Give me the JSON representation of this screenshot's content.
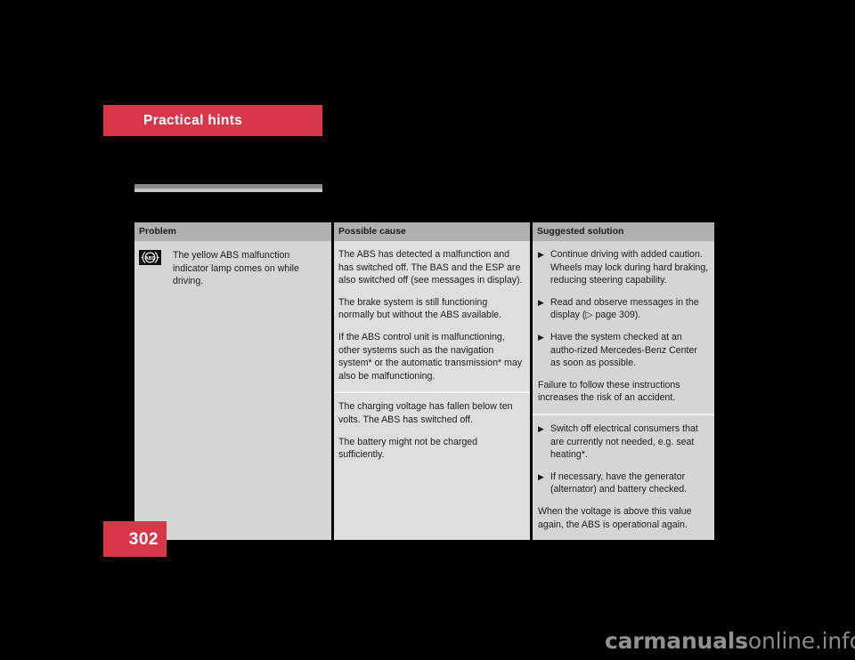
{
  "document": {
    "section_title": "Practical hints",
    "page_number": "302",
    "watermark_strong": "carmanuals",
    "watermark_light": "online.info",
    "accent_color": "#d8374a",
    "table_header_bg": "#b0b0b0",
    "table_body_bg": "#d5d5d5"
  },
  "table": {
    "headers": {
      "problem": "Problem",
      "possible_cause": "Possible cause",
      "suggested_solution": "Suggested solution"
    },
    "rows": [
      {
        "problem": {
          "icon": "abs-warning-lamp-icon",
          "text": "The yellow ABS malfunction indicator lamp comes on while driving."
        },
        "possible_cause": [
          "The ABS has detected a malfunction and has switched off. The BAS and the ESP are also switched off (see messages in display).",
          "The brake system is still functioning normally but without the ABS available.",
          "If the ABS control unit is malfunctioning, other systems such as the navigation system* or the automatic transmission* may also be malfunctioning."
        ],
        "suggested_solution": {
          "bullets": [
            "Continue driving with added caution. Wheels may lock during hard braking, reducing steering capability.",
            "Read and observe messages in the display (▷ page 309).",
            "Have the system checked at an autho-rized Mercedes-Benz Center as soon as possible."
          ],
          "note": "Failure to follow these instructions increases the risk of an accident."
        }
      },
      {
        "problem": {
          "icon": "",
          "text": ""
        },
        "possible_cause": [
          "The charging voltage has fallen below ten volts. The ABS has switched off.",
          "The battery might not be charged sufficiently."
        ],
        "suggested_solution": {
          "bullets": [
            "Switch off electrical consumers that are currently not needed, e.g. seat heating*.",
            "If necessary, have the generator (alternator) and battery checked."
          ],
          "note": "When the voltage is above this value again, the ABS is operational again."
        }
      }
    ],
    "bullet_marker": "▶"
  }
}
